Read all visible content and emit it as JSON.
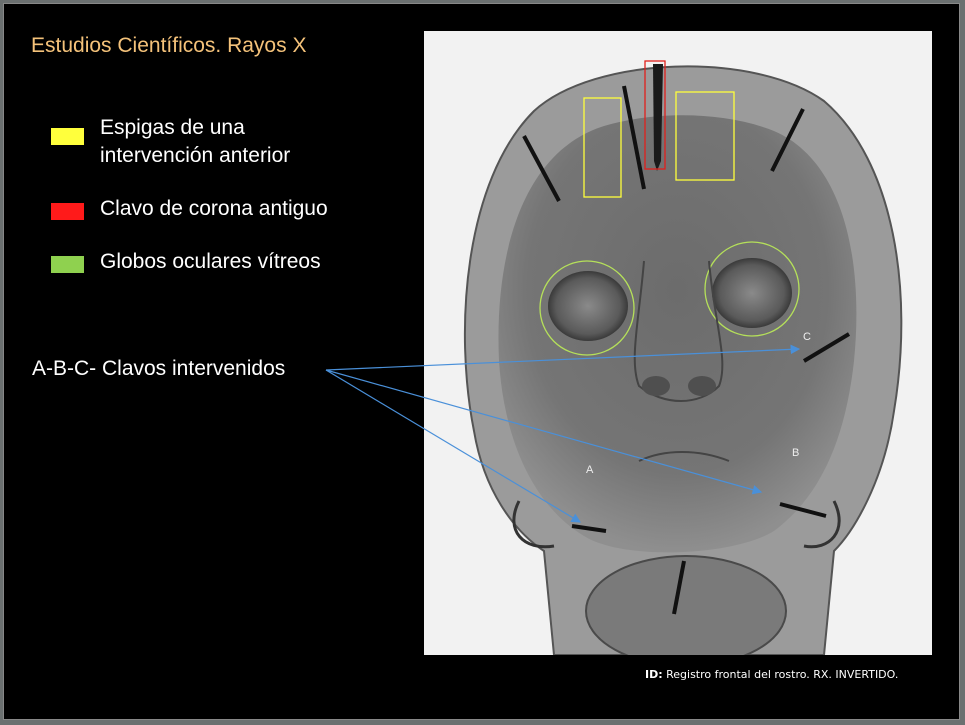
{
  "title": "Estudios Científicos. Rayos X",
  "legend": [
    {
      "label_line1": "Espigas  de una",
      "label_line2": "intervención anterior",
      "color": "#ffff3c"
    },
    {
      "label_line1": "Clavo de corona antiguo",
      "label_line2": "",
      "color": "#ff1a1a"
    },
    {
      "label_line1": "Globos oculares vítreos",
      "label_line2": "",
      "color": "#8fd14f"
    }
  ],
  "nails_label": "A-B-C- Clavos intervenidos",
  "markers": {
    "a": "A",
    "b": "B",
    "c": "C"
  },
  "caption": {
    "id_label": "ID:",
    "text": " Registro frontal del rostro. RX. INVERTIDO."
  },
  "colors": {
    "title": "#f4c27a",
    "arrow": "#4a90d9",
    "spike_box": "#ffff3c",
    "crown_nail_box": "#e0201c",
    "eye_circle": "#b5e05a"
  }
}
